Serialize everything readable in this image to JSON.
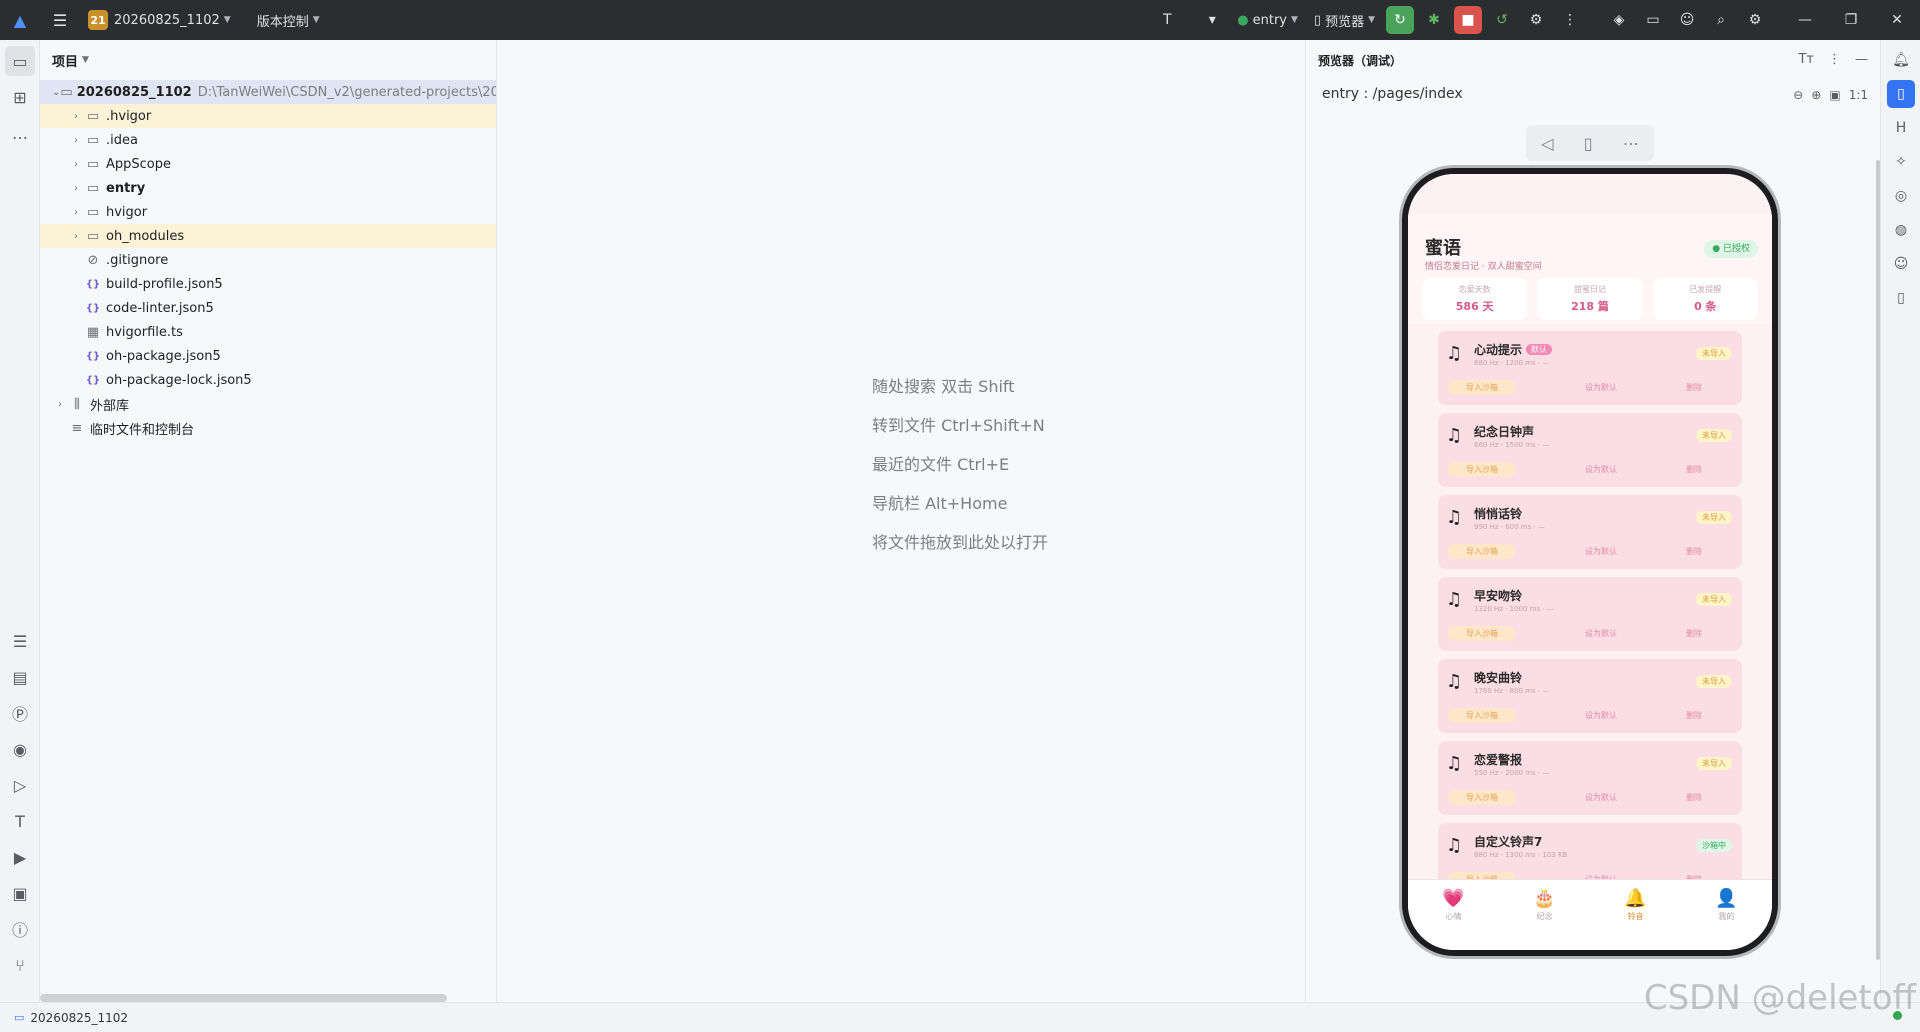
{
  "titlebar": {
    "project_badge": "21",
    "project_name": "20260825_1102",
    "vcs": "版本控制",
    "run_config": "entry",
    "device": "预览器"
  },
  "project_panel": {
    "title": "项目",
    "root_name": "20260825_1102",
    "root_path": "D:\\TanWeiWei\\CSDN_v2\\generated-projects\\2026082",
    "items": [
      {
        "label": ".hvigor",
        "type": "folder"
      },
      {
        "label": ".idea",
        "type": "folder"
      },
      {
        "label": "AppScope",
        "type": "folder"
      },
      {
        "label": "entry",
        "type": "module"
      },
      {
        "label": "hvigor",
        "type": "folder"
      },
      {
        "label": "oh_modules",
        "type": "folder"
      },
      {
        "label": ".gitignore",
        "type": "ignore"
      },
      {
        "label": "build-profile.json5",
        "type": "json"
      },
      {
        "label": "code-linter.json5",
        "type": "json"
      },
      {
        "label": "hvigorfile.ts",
        "type": "ts"
      },
      {
        "label": "oh-package.json5",
        "type": "json"
      },
      {
        "label": "oh-package-lock.json5",
        "type": "json"
      }
    ],
    "external_libs": "外部库",
    "scratches": "临时文件和控制台"
  },
  "editor_hints": [
    "随处搜索 双击 Shift",
    "转到文件 Ctrl+Shift+N",
    "最近的文件 Ctrl+E",
    "导航栏 Alt+Home",
    "将文件拖放到此处以打开"
  ],
  "previewer": {
    "title": "预览器（调试）",
    "route": "entry : /pages/index",
    "zoom_label": "1:1"
  },
  "app": {
    "title": "蜜语",
    "subtitle": "情侣恋爱日记 · 双人甜蜜空间",
    "auth_badge": "已授权",
    "stats": [
      {
        "label": "恋爱天数",
        "value": "586 天"
      },
      {
        "label": "甜蜜日记",
        "value": "218 篇"
      },
      {
        "label": "已发提醒",
        "value": "0 条"
      }
    ],
    "ringtones": [
      {
        "name": "心动提示",
        "tag": "默认",
        "meta": "880 Hz · 1200 ms · —",
        "status": "未导入",
        "status_color": "yellow"
      },
      {
        "name": "纪念日钟声",
        "tag": "",
        "meta": "660 Hz · 1500 ms · —",
        "status": "未导入",
        "status_color": "yellow"
      },
      {
        "name": "悄悄话铃",
        "tag": "",
        "meta": "990 Hz · 600 ms · —",
        "status": "未导入",
        "status_color": "yellow"
      },
      {
        "name": "早安吻铃",
        "tag": "",
        "meta": "1320 Hz · 1000 ms · —",
        "status": "未导入",
        "status_color": "yellow"
      },
      {
        "name": "晚安曲铃",
        "tag": "",
        "meta": "1760 Hz · 800 ms · —",
        "status": "未导入",
        "status_color": "yellow"
      },
      {
        "name": "恋爱警报",
        "tag": "",
        "meta": "550 Hz · 2000 ms · —",
        "status": "未导入",
        "status_color": "yellow"
      },
      {
        "name": "自定义铃声7",
        "tag": "",
        "meta": "880 Hz · 1300 ms · 103 KB",
        "status": "沙箱中",
        "status_color": "green"
      }
    ],
    "actions": {
      "import": "导入沙箱",
      "default": "设为默认",
      "delete": "删除"
    },
    "tabs": [
      {
        "label": "心情",
        "icon": "💗"
      },
      {
        "label": "纪念",
        "icon": "🎂"
      },
      {
        "label": "铃音",
        "icon": "🔔"
      },
      {
        "label": "我的",
        "icon": "👤"
      }
    ],
    "active_tab": 2
  },
  "statusbar": {
    "project": "20260825_1102"
  },
  "watermark": "CSDN @deletoff"
}
